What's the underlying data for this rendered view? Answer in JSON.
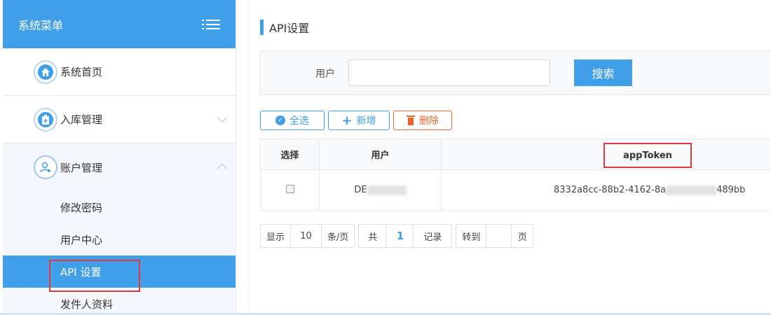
{
  "sidebar": {
    "title": "系统菜单",
    "items": [
      {
        "label": "系统首页",
        "icon": "home-icon"
      },
      {
        "label": "入库管理",
        "icon": "clipboard-icon"
      },
      {
        "label": "账户管理",
        "icon": "user-icon"
      }
    ],
    "sub_items": [
      {
        "label": "修改密码"
      },
      {
        "label": "用户中心"
      },
      {
        "label": "API 设置",
        "active": true
      },
      {
        "label": "发件人资料"
      }
    ]
  },
  "main": {
    "title": "API设置",
    "search": {
      "user_label": "用户",
      "user_value": "",
      "button": "搜索"
    },
    "toolbar": {
      "select_all": "全选",
      "add": "新增",
      "delete": "删除"
    },
    "table": {
      "headers": [
        "选择",
        "用户",
        "appToken"
      ],
      "rows": [
        {
          "user_prefix": "DE",
          "token_prefix": "8332a8cc-88b2-4162-8a",
          "token_suffix": "489bb"
        }
      ]
    },
    "pager": {
      "show": "显示",
      "per_page": "10",
      "unit": "条/页",
      "total_label": "共",
      "total": "1",
      "record": "记录",
      "goto": "转到",
      "goto_value": "",
      "page": "页"
    }
  },
  "colors": {
    "accent": "#3f9fe8",
    "danger": "#e8642a",
    "highlight": "#e0383c"
  }
}
